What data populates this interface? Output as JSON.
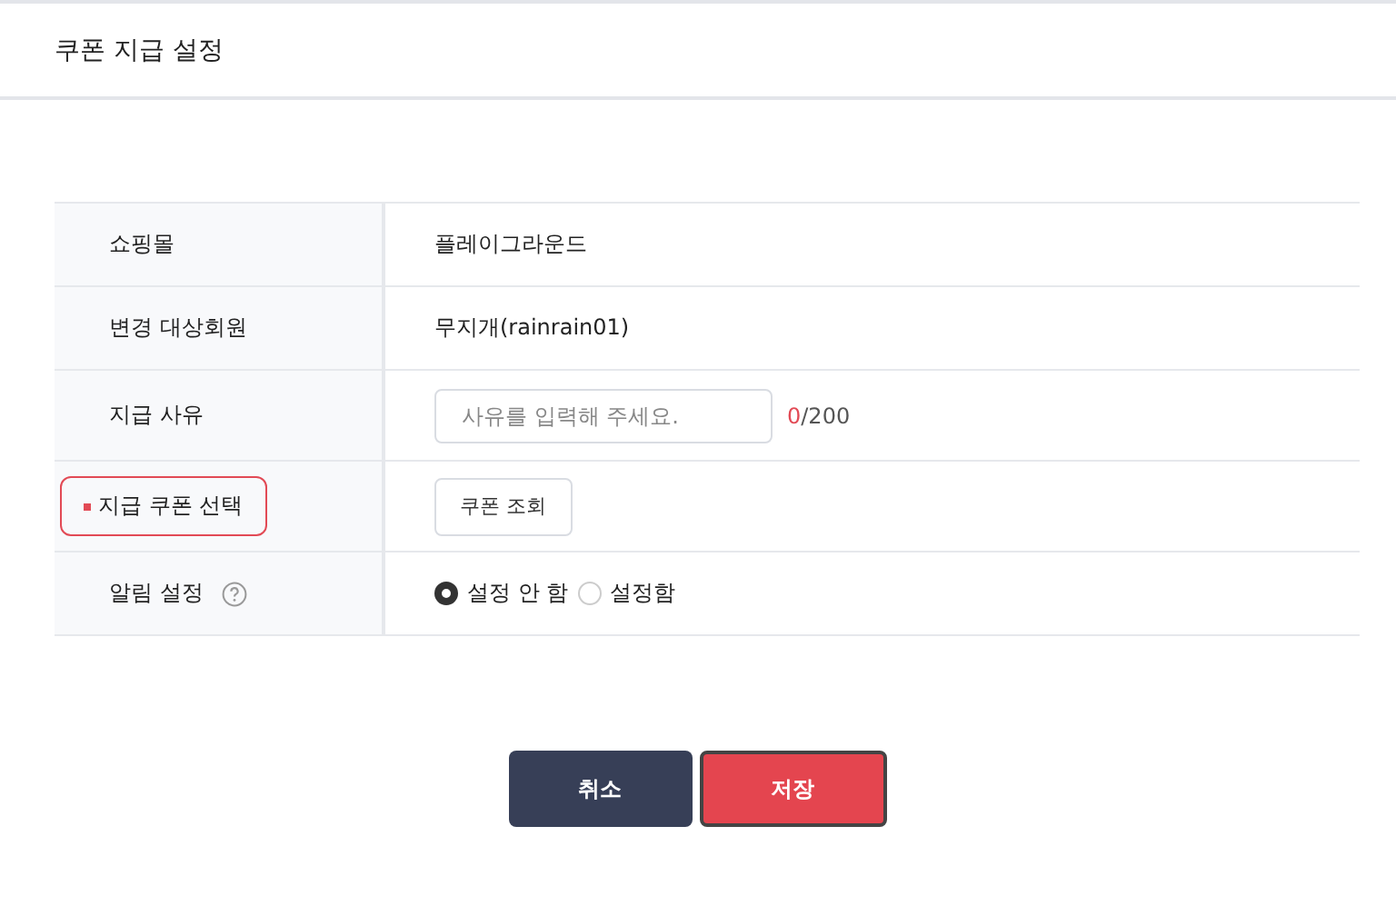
{
  "title": "쿠폰 지급 설정",
  "rows": [
    {
      "kind": "text",
      "label": "쇼핑몰",
      "required": false,
      "highlighted": false,
      "value": "플레이그라운드"
    },
    {
      "kind": "text",
      "label": "변경 대상회원",
      "required": false,
      "highlighted": false,
      "value": "무지개(rainrain01)"
    },
    {
      "kind": "input",
      "label": "지급 사유",
      "required": false,
      "highlighted": false,
      "placeholder": "사유를 입력해 주세요.",
      "count": "0",
      "limit": "/200"
    },
    {
      "kind": "button",
      "label": "지급 쿠폰 선택",
      "required": true,
      "highlighted": true,
      "button": "쿠폰 조회"
    },
    {
      "kind": "radio",
      "label": "알림 설정",
      "required": false,
      "highlighted": false,
      "help": true,
      "options": [
        {
          "label": "설정 안 함",
          "selected": true
        },
        {
          "label": "설정함",
          "selected": false
        }
      ]
    }
  ],
  "buttons": [
    {
      "kind": "cancel",
      "label": "취소"
    },
    {
      "kind": "save",
      "label": "저장"
    }
  ]
}
